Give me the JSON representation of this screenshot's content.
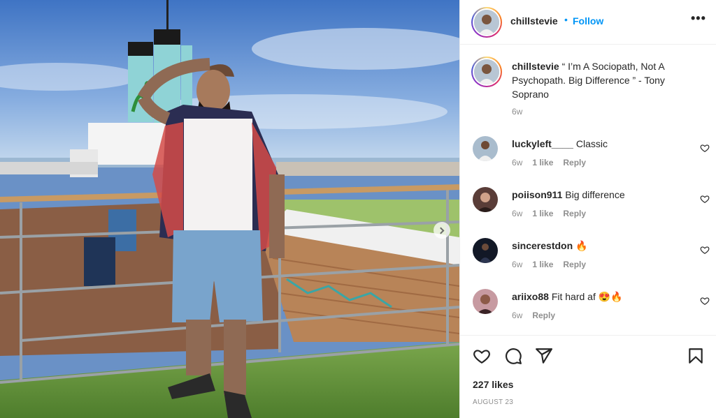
{
  "post": {
    "author": "chillstevie",
    "follow_dot": "•",
    "follow_label": "Follow",
    "more_label": "•••"
  },
  "caption": {
    "user": "chillstevie",
    "text": " “ I’m A Sociopath, Not A Psychopath. Big Difference ” - Tony Soprano",
    "time": "6w"
  },
  "comments": [
    {
      "user": "luckyleft____",
      "text": "Classic",
      "time": "6w",
      "likes": "1 like",
      "reply": "Reply"
    },
    {
      "user": "poiison911",
      "text": "Big difference",
      "time": "6w",
      "likes": "1 like",
      "reply": "Reply"
    },
    {
      "user": "sincerestdon",
      "text": "🔥",
      "time": "6w",
      "likes": "1 like",
      "reply": "Reply"
    },
    {
      "user": "ariixo88",
      "text": "Fit hard af 😍🔥",
      "time": "6w",
      "likes": "",
      "reply": "Reply"
    }
  ],
  "actions": {
    "like_icon": "heart-icon",
    "comment_icon": "comment-icon",
    "share_icon": "share-icon",
    "save_icon": "bookmark-icon",
    "likes": "227 likes",
    "date": "AUGUST 23"
  },
  "colors": {
    "accent": "#0095f6",
    "text": "#262626",
    "muted": "#8e8e8e"
  }
}
